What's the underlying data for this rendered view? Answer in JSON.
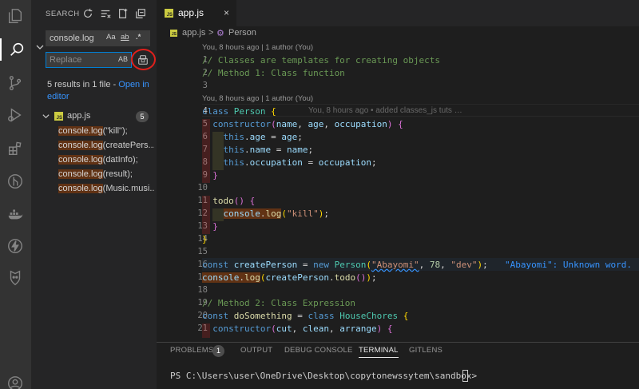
{
  "activity_bar": [
    {
      "name": "explorer-icon"
    },
    {
      "name": "search-icon",
      "active": true
    },
    {
      "name": "source-control-icon"
    },
    {
      "name": "run-debug-icon"
    },
    {
      "name": "extensions-icon"
    },
    {
      "name": "gitlens-icon"
    },
    {
      "name": "docker-icon"
    },
    {
      "name": "lightning-icon"
    },
    {
      "name": "remote-icon"
    },
    {
      "name": "account-icon"
    }
  ],
  "search": {
    "title": "SEARCH",
    "query": "console.log",
    "opt_case": "Aa",
    "opt_word": "ab",
    "opt_regex": ".*",
    "replace_placeholder": "Replace",
    "preserve_case": "AB",
    "results_summary": "5 results in 1 file - ",
    "results_link": "Open in editor",
    "file": {
      "name": "app.js",
      "count": "5",
      "icon_label": "JS"
    },
    "matches": [
      {
        "hit": "console.log",
        "rest": "(\"kill\");"
      },
      {
        "hit": "console.log",
        "rest": "(createPers..."
      },
      {
        "hit": "console.log",
        "rest": "(datInfo);"
      },
      {
        "hit": "console.log",
        "rest": "(result);"
      },
      {
        "hit": "console.log",
        "rest": "(Music.musi..."
      }
    ]
  },
  "editor": {
    "tab_label": "app.js",
    "tab_icon_label": "JS",
    "tab_close": "×",
    "breadcrumb_file": "app.js",
    "breadcrumb_sep": ">",
    "breadcrumb_symbol": "Person",
    "lens_1": "You, 8 hours ago | 1 author (You)",
    "lens_2": "You, 8 hours ago | 1 author (You)",
    "blame": "You, 8 hours ago • added classes_js tuts …",
    "diagnostic": "\"Abayomi\": Unknown word.",
    "line_numbers": [
      "1",
      "2",
      "3",
      "4",
      "5",
      "6",
      "7",
      "8",
      "9",
      "10",
      "11",
      "12",
      "13",
      "14",
      "15",
      "16",
      "17",
      "18",
      "19",
      "20",
      "21"
    ]
  },
  "panel": {
    "tabs": [
      "PROBLEMS",
      "OUTPUT",
      "DEBUG CONSOLE",
      "TERMINAL",
      "GITLENS"
    ],
    "problems_count": "1",
    "active_tab": "TERMINAL",
    "terminal_prompt": "PS C:\\Users\\user\\OneDrive\\Desktop\\copytonewssytem\\sandbox> "
  },
  "colors": {
    "accent": "#007fd4",
    "highlight_circle": "#e0201c",
    "find_match": "#613214",
    "link": "#3794ff"
  }
}
